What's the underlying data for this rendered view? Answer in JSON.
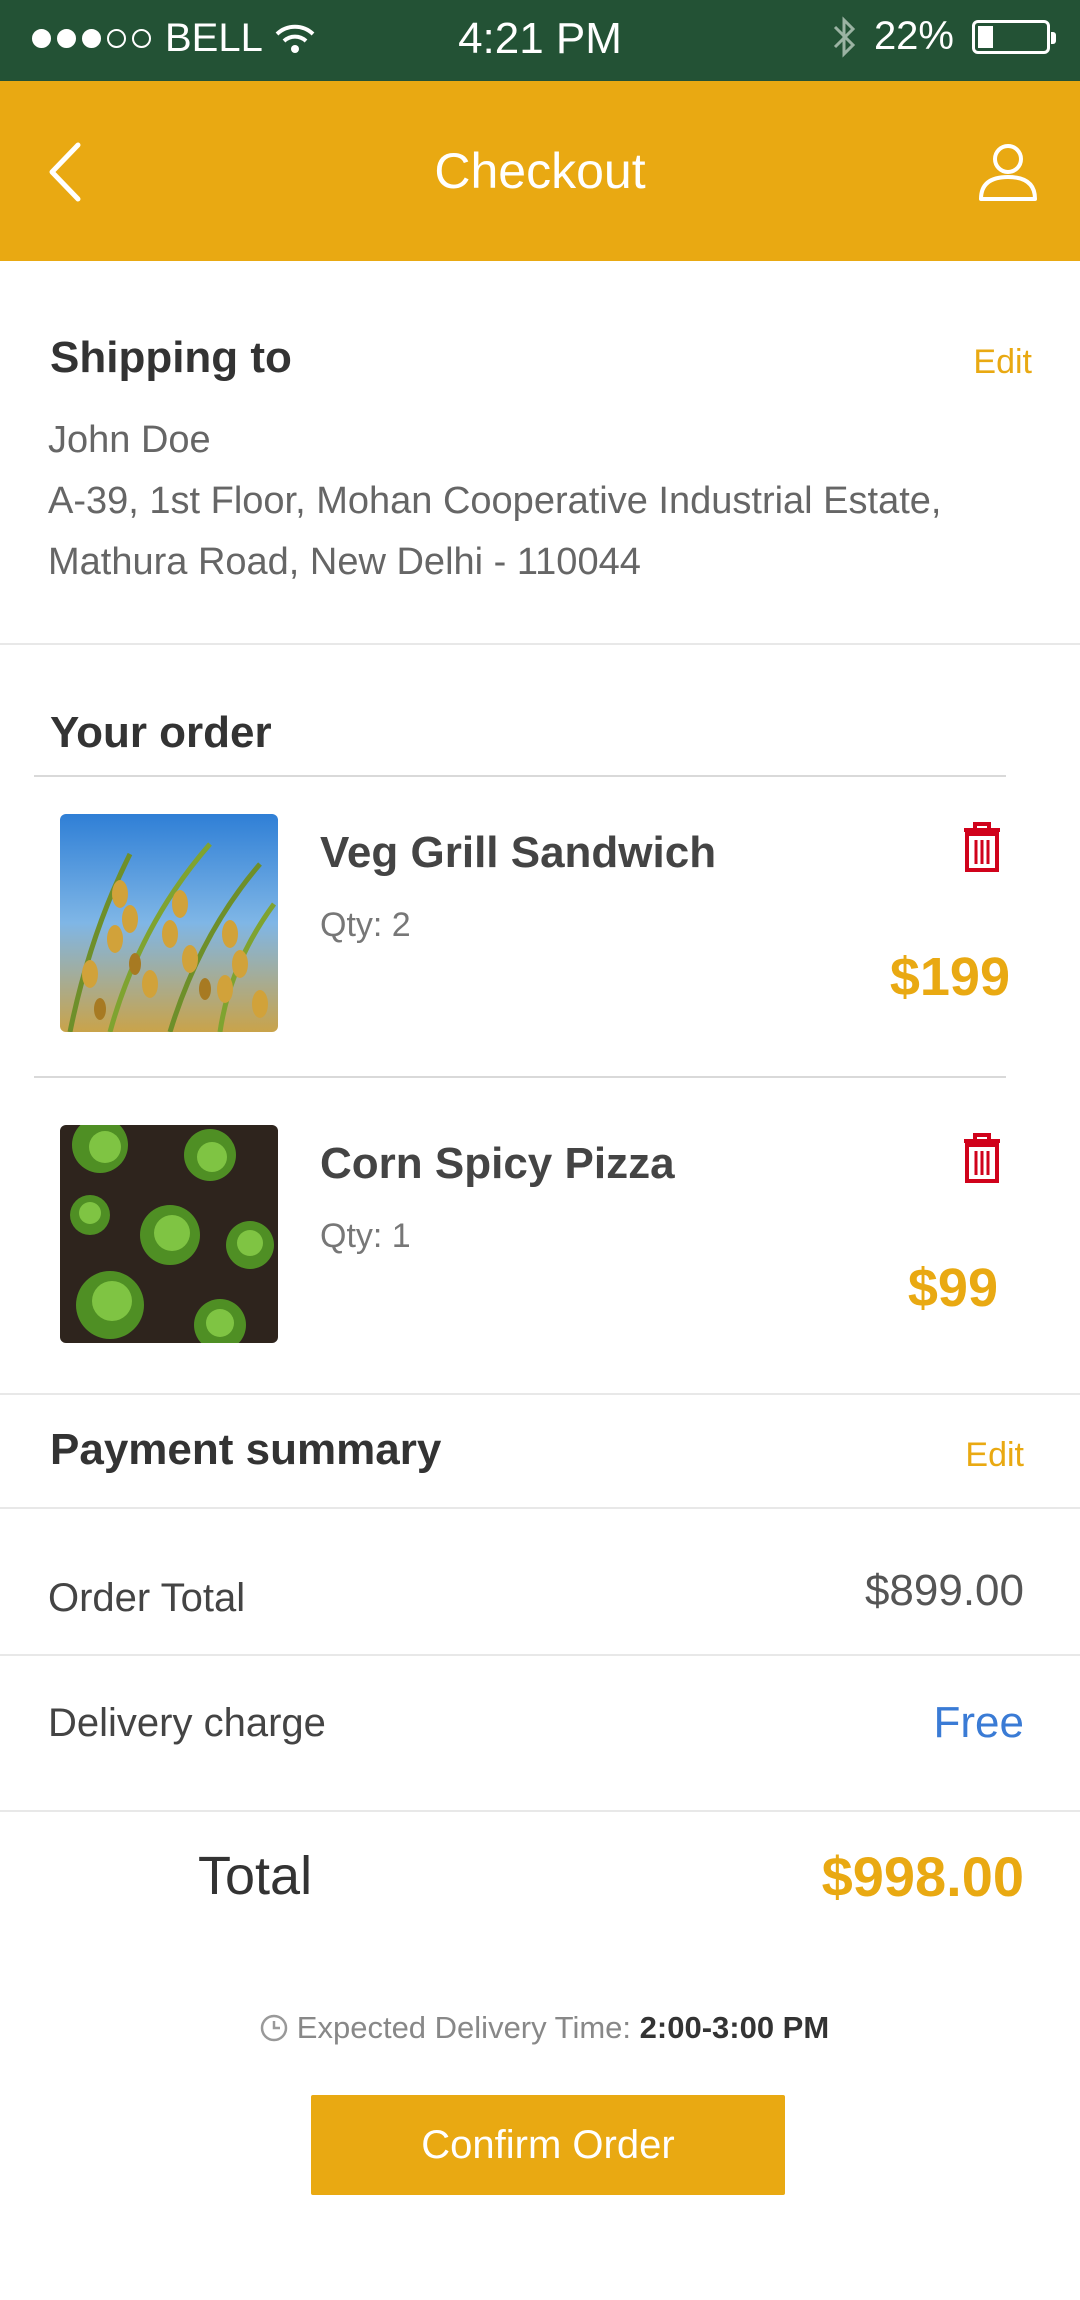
{
  "status": {
    "carrier": "BELL",
    "time": "4:21 PM",
    "battery": "22%",
    "battery_level": 0.22
  },
  "header": {
    "title": "Checkout"
  },
  "shipping": {
    "title": "Shipping to",
    "edit_label": "Edit",
    "name": "John Doe",
    "address_line1": "A-39, 1st Floor, Mohan Cooperative Industrial Estate,",
    "address_line2": "Mathura Road, New Delhi - 110044"
  },
  "order": {
    "title": "Your order",
    "items": [
      {
        "name": "Veg Grill Sandwich",
        "qty": "Qty: 2",
        "price": "$199"
      },
      {
        "name": "Corn Spicy Pizza",
        "qty": "Qty: 1",
        "price": "$99"
      }
    ]
  },
  "payment": {
    "title": "Payment summary",
    "edit_label": "Edit",
    "order_total_label": "Order Total",
    "order_total_value": "$899.00",
    "delivery_label": "Delivery charge",
    "delivery_value": "Free",
    "total_label": "Total",
    "total_value": "$998.00"
  },
  "delivery_time": {
    "label": "Expected Delivery Time:",
    "value": "2:00-3:00 PM"
  },
  "confirm_label": "Confirm Order",
  "colors": {
    "status_bar": "#235235",
    "accent": "#e9a912",
    "delete": "#d0021b",
    "free": "#3a7bd5"
  },
  "icons": [
    "back-chevron-icon",
    "profile-icon",
    "wifi-icon",
    "bluetooth-icon",
    "battery-icon",
    "trash-icon",
    "clock-icon"
  ]
}
